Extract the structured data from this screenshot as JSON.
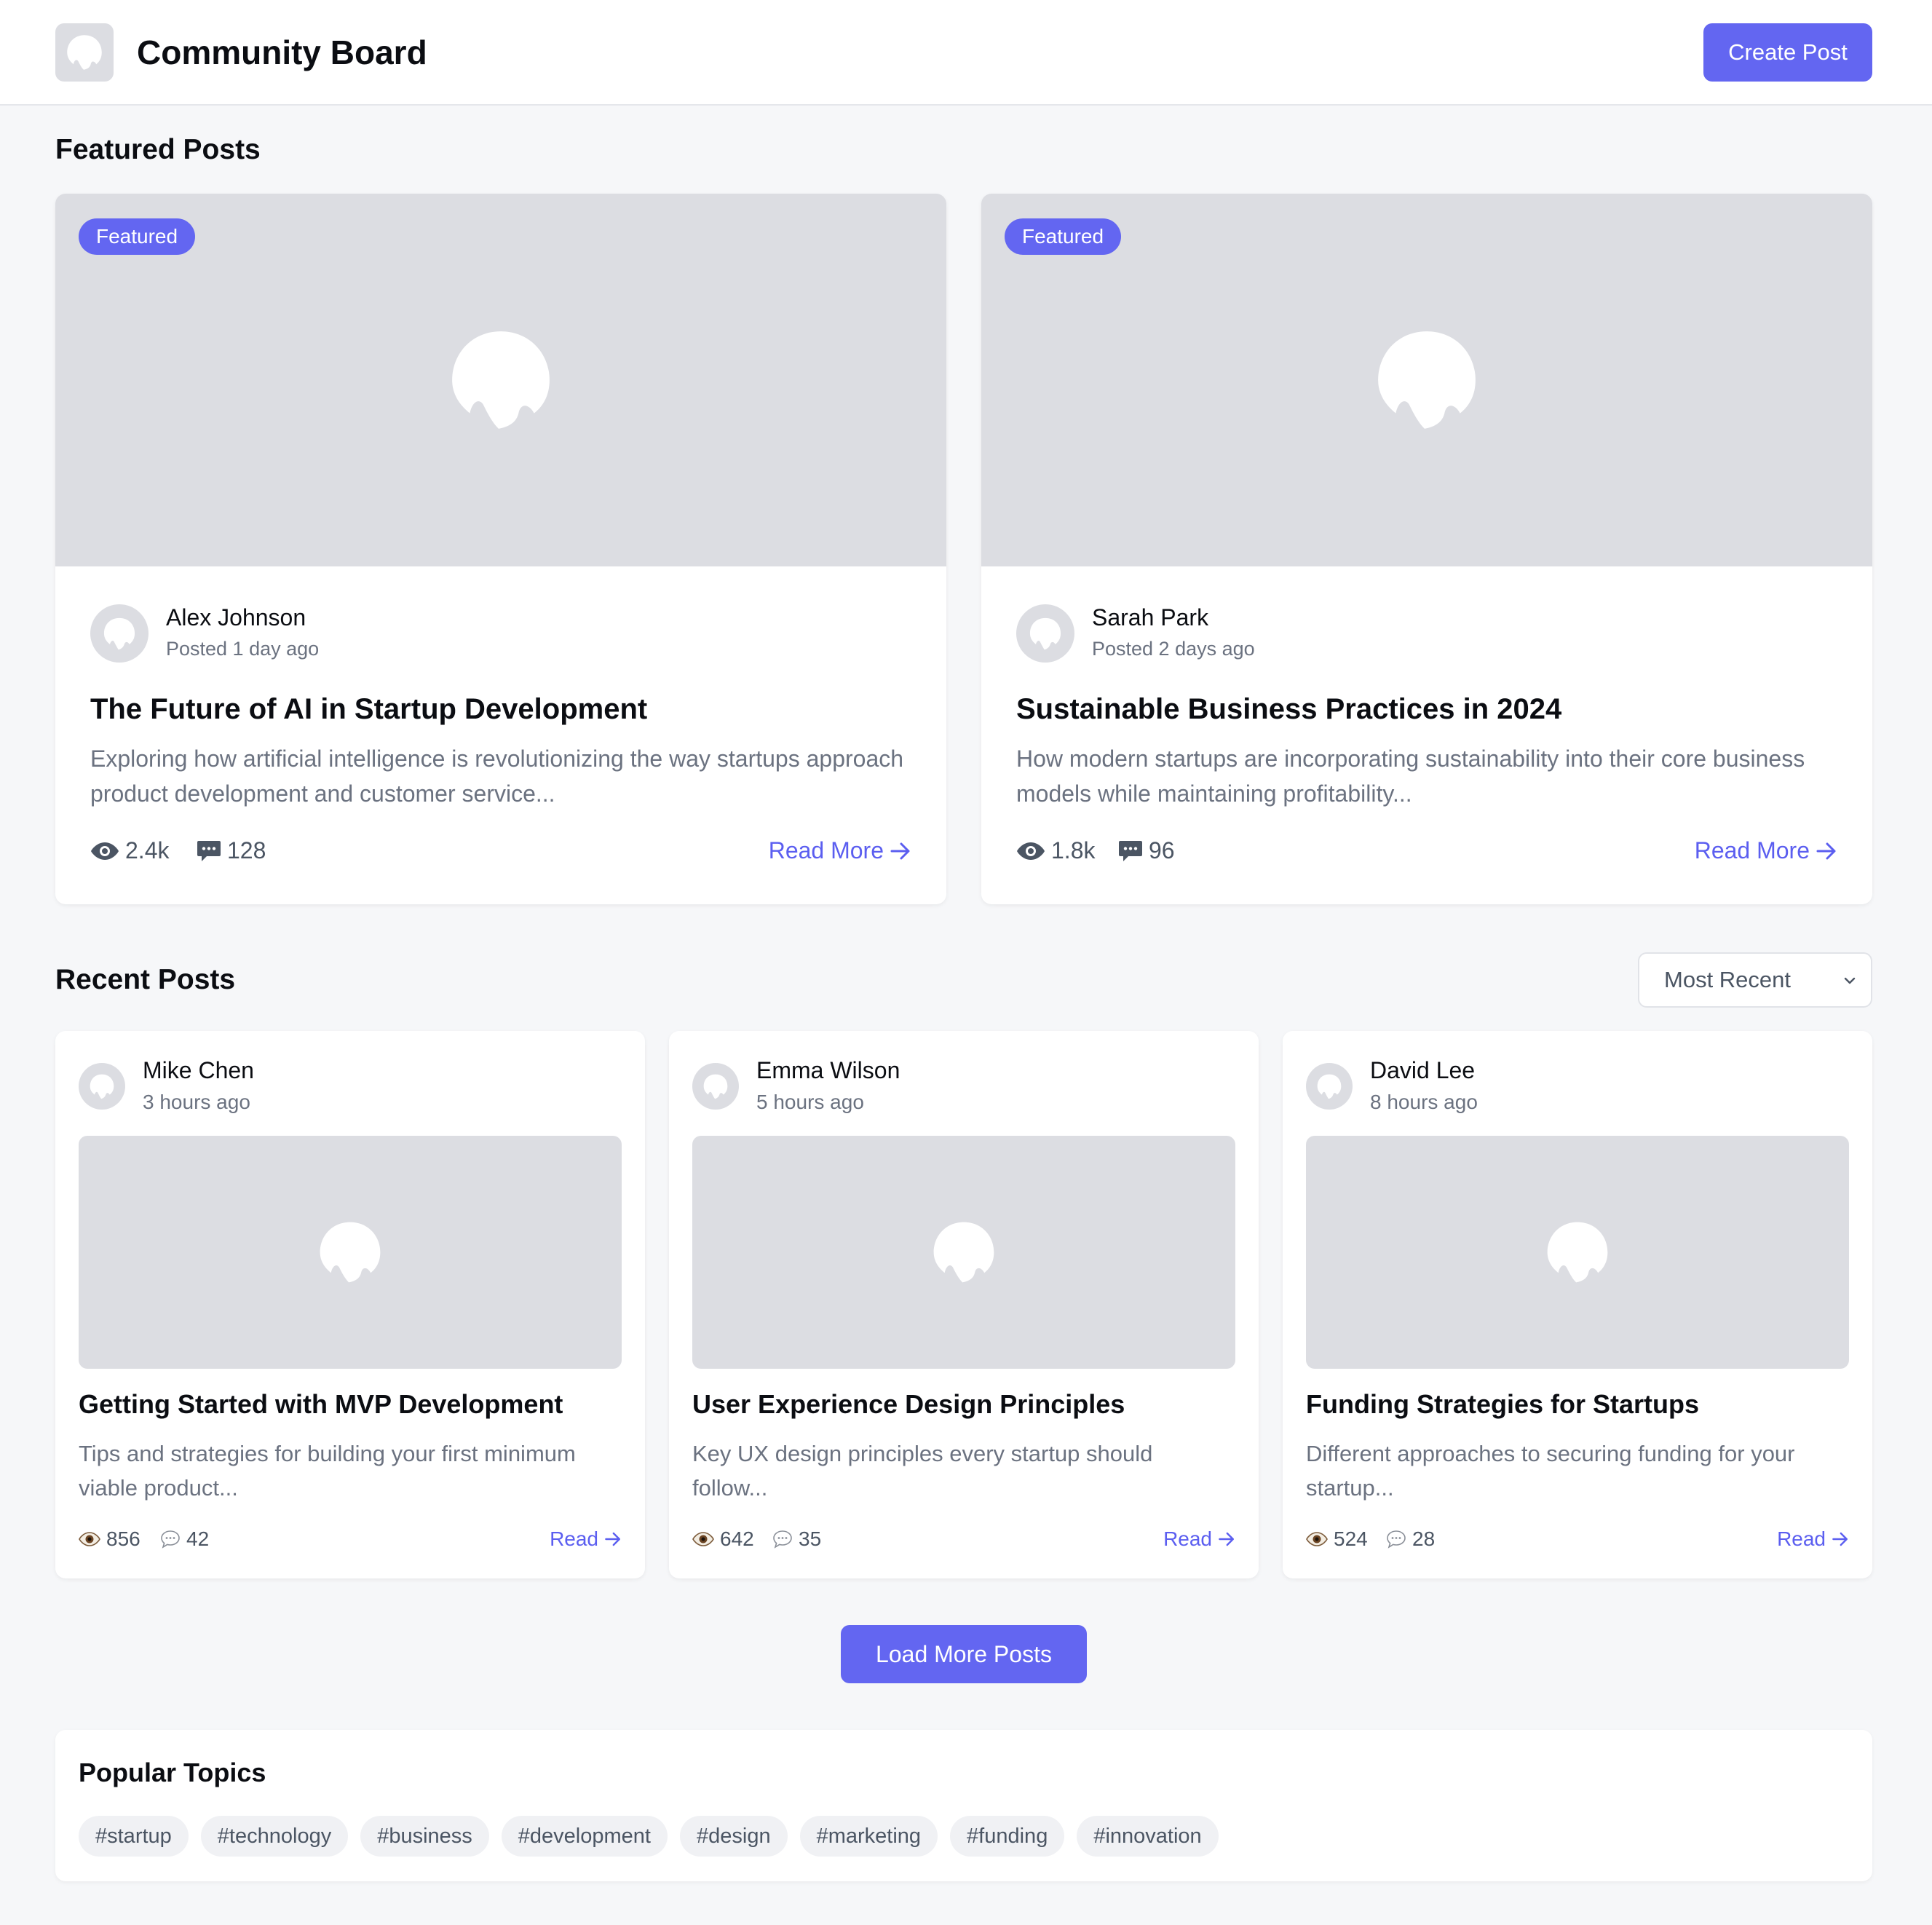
{
  "header": {
    "title": "Community Board",
    "create_label": "Create Post"
  },
  "featured": {
    "heading": "Featured Posts",
    "posts": [
      {
        "badge": "Featured",
        "author": "Alex Johnson",
        "time": "Posted 1 day ago",
        "title": "The Future of AI in Startup Development",
        "excerpt": "Exploring how artificial intelligence is revolutionizing the way startups approach product development and customer service...",
        "views": "2.4k",
        "comments": "128",
        "read_label": "Read More"
      },
      {
        "badge": "Featured",
        "author": "Sarah Park",
        "time": "Posted 2 days ago",
        "title": "Sustainable Business Practices in 2024",
        "excerpt": "How modern startups are incorporating sustainability into their core business models while maintaining profitability...",
        "views": "1.8k",
        "comments": "96",
        "read_label": "Read More"
      }
    ]
  },
  "recent": {
    "heading": "Recent Posts",
    "sort_selected": "Most Recent",
    "posts": [
      {
        "author": "Mike Chen",
        "time": "3 hours ago",
        "title": "Getting Started with MVP Development",
        "excerpt": "Tips and strategies for building your first minimum viable product...",
        "views": "856",
        "comments": "42",
        "read_label": "Read"
      },
      {
        "author": "Emma Wilson",
        "time": "5 hours ago",
        "title": "User Experience Design Principles",
        "excerpt": "Key UX design principles every startup should follow...",
        "views": "642",
        "comments": "35",
        "read_label": "Read"
      },
      {
        "author": "David Lee",
        "time": "8 hours ago",
        "title": "Funding Strategies for Startups",
        "excerpt": "Different approaches to securing funding for your startup...",
        "views": "524",
        "comments": "28",
        "read_label": "Read"
      }
    ],
    "load_more_label": "Load More Posts"
  },
  "topics": {
    "heading": "Popular Topics",
    "tags": [
      "#startup",
      "#technology",
      "#business",
      "#development",
      "#design",
      "#marketing",
      "#funding",
      "#innovation"
    ]
  },
  "colors": {
    "accent": "#6366f1",
    "placeholder": "#dcdde2",
    "background": "#f6f7f9"
  },
  "icons": {
    "image_placeholder": "user-silhouette-icon",
    "views_featured": "eye-icon",
    "comments_featured": "speech-bubble-icon",
    "views_recent": "eye-emoji-icon",
    "comments_recent": "speech-bubble-emoji-icon",
    "read_arrow": "arrow-right-icon",
    "select_chevron": "chevron-down-icon"
  }
}
